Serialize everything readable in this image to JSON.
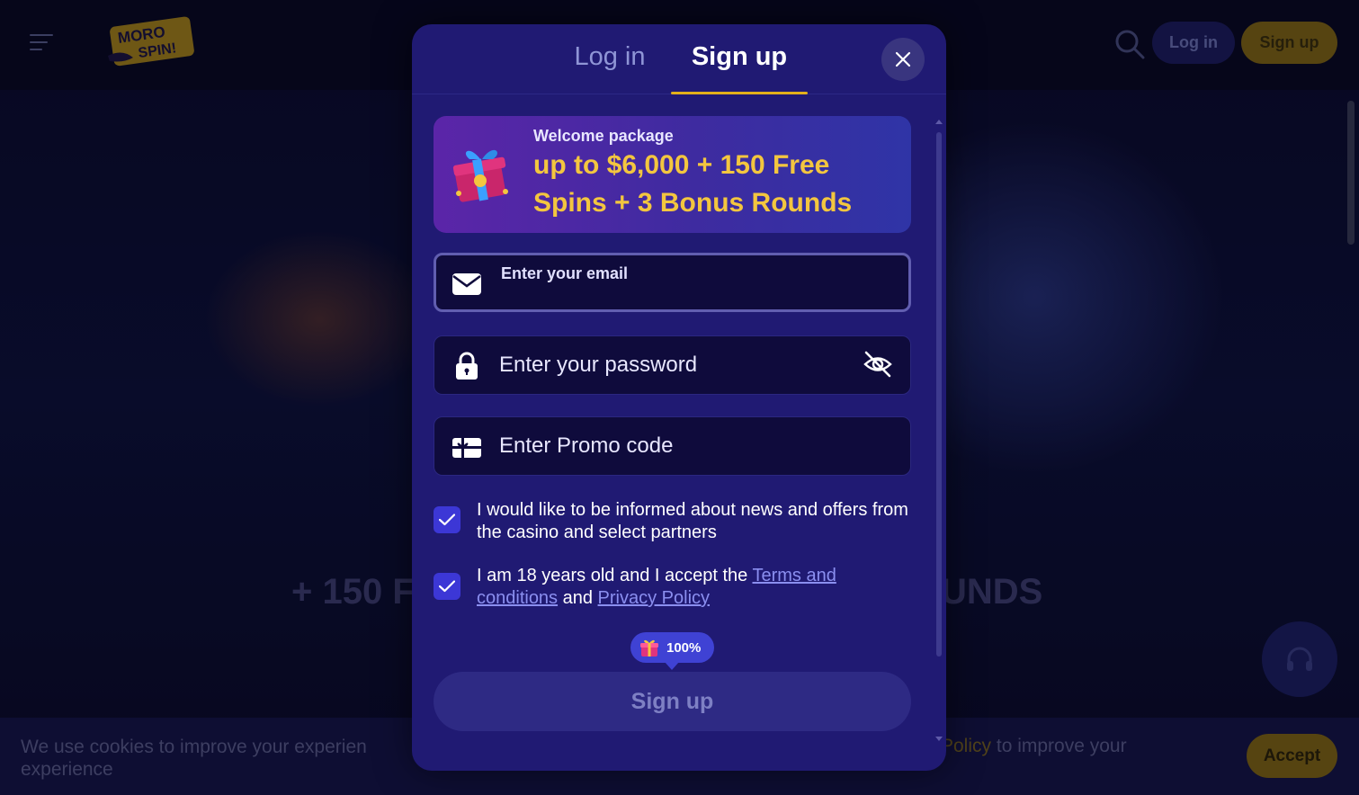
{
  "background": {
    "nav": {
      "login_label": "Log in",
      "signup_label": "Sign up",
      "logo_text": "MORO SPIN!"
    },
    "hero": {
      "left_text": "+ 150 F",
      "right_text": "UNDS"
    },
    "cookie": {
      "text_left": "We use cookies to improve your experien experience",
      "text_right_link": "Policy",
      "text_right_rest": " to improve your",
      "accept_label": "Accept"
    }
  },
  "modal": {
    "tabs": {
      "login": "Log in",
      "signup": "Sign up"
    },
    "promo": {
      "small": "Welcome package",
      "big": "up to $6,000 + 150 Free Spins + 3 Bonus Rounds"
    },
    "email": {
      "label": "Enter your email",
      "value": ""
    },
    "password": {
      "placeholder": "Enter your password"
    },
    "promo_code": {
      "placeholder": "Enter Promo code"
    },
    "checkbox_news": {
      "text": "I would like to be informed about news and offers from the casino and select partners",
      "checked": true
    },
    "checkbox_age": {
      "text_before": "I am 18 years old and I accept the ",
      "terms_link": "Terms and conditions",
      "text_mid": " and ",
      "privacy_link": "Privacy Policy",
      "checked": true
    },
    "bonus_badge": "100%",
    "submit_label": "Sign up"
  },
  "colors": {
    "modal_bg": "#201a73",
    "accent_gold": "#e2b01c",
    "checkbox_blue": "#3c37d6",
    "promo_gold_text": "#f3c63f"
  }
}
